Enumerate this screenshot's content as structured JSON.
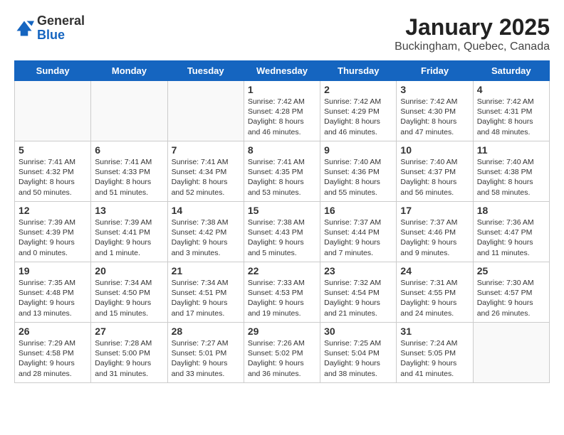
{
  "header": {
    "logo_general": "General",
    "logo_blue": "Blue",
    "main_title": "January 2025",
    "subtitle": "Buckingham, Quebec, Canada"
  },
  "calendar": {
    "days_of_week": [
      "Sunday",
      "Monday",
      "Tuesday",
      "Wednesday",
      "Thursday",
      "Friday",
      "Saturday"
    ],
    "weeks": [
      [
        {
          "day": "",
          "info": ""
        },
        {
          "day": "",
          "info": ""
        },
        {
          "day": "",
          "info": ""
        },
        {
          "day": "1",
          "info": "Sunrise: 7:42 AM\nSunset: 4:28 PM\nDaylight: 8 hours\nand 46 minutes."
        },
        {
          "day": "2",
          "info": "Sunrise: 7:42 AM\nSunset: 4:29 PM\nDaylight: 8 hours\nand 46 minutes."
        },
        {
          "day": "3",
          "info": "Sunrise: 7:42 AM\nSunset: 4:30 PM\nDaylight: 8 hours\nand 47 minutes."
        },
        {
          "day": "4",
          "info": "Sunrise: 7:42 AM\nSunset: 4:31 PM\nDaylight: 8 hours\nand 48 minutes."
        }
      ],
      [
        {
          "day": "5",
          "info": "Sunrise: 7:41 AM\nSunset: 4:32 PM\nDaylight: 8 hours\nand 50 minutes."
        },
        {
          "day": "6",
          "info": "Sunrise: 7:41 AM\nSunset: 4:33 PM\nDaylight: 8 hours\nand 51 minutes."
        },
        {
          "day": "7",
          "info": "Sunrise: 7:41 AM\nSunset: 4:34 PM\nDaylight: 8 hours\nand 52 minutes."
        },
        {
          "day": "8",
          "info": "Sunrise: 7:41 AM\nSunset: 4:35 PM\nDaylight: 8 hours\nand 53 minutes."
        },
        {
          "day": "9",
          "info": "Sunrise: 7:40 AM\nSunset: 4:36 PM\nDaylight: 8 hours\nand 55 minutes."
        },
        {
          "day": "10",
          "info": "Sunrise: 7:40 AM\nSunset: 4:37 PM\nDaylight: 8 hours\nand 56 minutes."
        },
        {
          "day": "11",
          "info": "Sunrise: 7:40 AM\nSunset: 4:38 PM\nDaylight: 8 hours\nand 58 minutes."
        }
      ],
      [
        {
          "day": "12",
          "info": "Sunrise: 7:39 AM\nSunset: 4:39 PM\nDaylight: 9 hours\nand 0 minutes."
        },
        {
          "day": "13",
          "info": "Sunrise: 7:39 AM\nSunset: 4:41 PM\nDaylight: 9 hours\nand 1 minute."
        },
        {
          "day": "14",
          "info": "Sunrise: 7:38 AM\nSunset: 4:42 PM\nDaylight: 9 hours\nand 3 minutes."
        },
        {
          "day": "15",
          "info": "Sunrise: 7:38 AM\nSunset: 4:43 PM\nDaylight: 9 hours\nand 5 minutes."
        },
        {
          "day": "16",
          "info": "Sunrise: 7:37 AM\nSunset: 4:44 PM\nDaylight: 9 hours\nand 7 minutes."
        },
        {
          "day": "17",
          "info": "Sunrise: 7:37 AM\nSunset: 4:46 PM\nDaylight: 9 hours\nand 9 minutes."
        },
        {
          "day": "18",
          "info": "Sunrise: 7:36 AM\nSunset: 4:47 PM\nDaylight: 9 hours\nand 11 minutes."
        }
      ],
      [
        {
          "day": "19",
          "info": "Sunrise: 7:35 AM\nSunset: 4:48 PM\nDaylight: 9 hours\nand 13 minutes."
        },
        {
          "day": "20",
          "info": "Sunrise: 7:34 AM\nSunset: 4:50 PM\nDaylight: 9 hours\nand 15 minutes."
        },
        {
          "day": "21",
          "info": "Sunrise: 7:34 AM\nSunset: 4:51 PM\nDaylight: 9 hours\nand 17 minutes."
        },
        {
          "day": "22",
          "info": "Sunrise: 7:33 AM\nSunset: 4:53 PM\nDaylight: 9 hours\nand 19 minutes."
        },
        {
          "day": "23",
          "info": "Sunrise: 7:32 AM\nSunset: 4:54 PM\nDaylight: 9 hours\nand 21 minutes."
        },
        {
          "day": "24",
          "info": "Sunrise: 7:31 AM\nSunset: 4:55 PM\nDaylight: 9 hours\nand 24 minutes."
        },
        {
          "day": "25",
          "info": "Sunrise: 7:30 AM\nSunset: 4:57 PM\nDaylight: 9 hours\nand 26 minutes."
        }
      ],
      [
        {
          "day": "26",
          "info": "Sunrise: 7:29 AM\nSunset: 4:58 PM\nDaylight: 9 hours\nand 28 minutes."
        },
        {
          "day": "27",
          "info": "Sunrise: 7:28 AM\nSunset: 5:00 PM\nDaylight: 9 hours\nand 31 minutes."
        },
        {
          "day": "28",
          "info": "Sunrise: 7:27 AM\nSunset: 5:01 PM\nDaylight: 9 hours\nand 33 minutes."
        },
        {
          "day": "29",
          "info": "Sunrise: 7:26 AM\nSunset: 5:02 PM\nDaylight: 9 hours\nand 36 minutes."
        },
        {
          "day": "30",
          "info": "Sunrise: 7:25 AM\nSunset: 5:04 PM\nDaylight: 9 hours\nand 38 minutes."
        },
        {
          "day": "31",
          "info": "Sunrise: 7:24 AM\nSunset: 5:05 PM\nDaylight: 9 hours\nand 41 minutes."
        },
        {
          "day": "",
          "info": ""
        }
      ]
    ]
  }
}
